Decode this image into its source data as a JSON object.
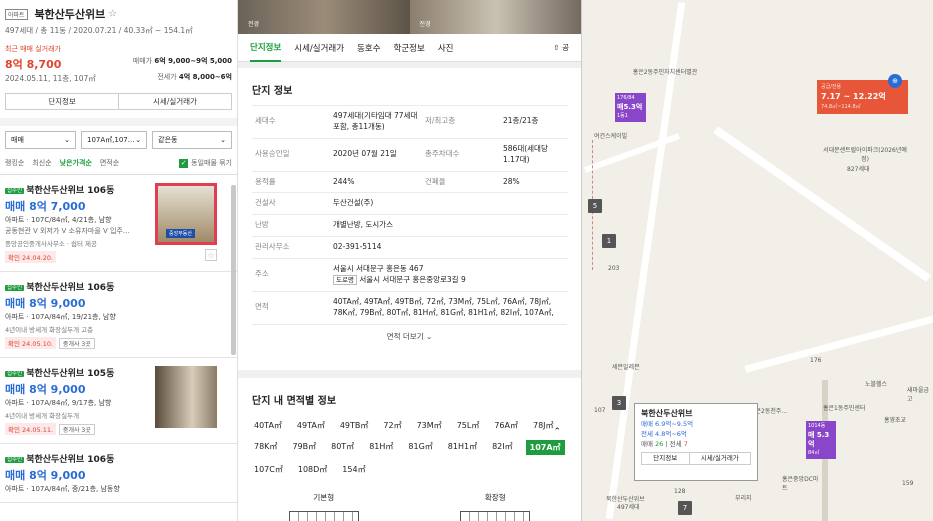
{
  "left": {
    "badge": "아파트",
    "title": "북한산두산위브",
    "star": "☆",
    "summary": "497세대 / 총 11동 / 2020.07.21 / 40.33㎡ ~ 154.1㎡",
    "recent_label": "최근 매매 실거래가",
    "recent_price": "8억 8,700",
    "recent_date": "2024.05.11, 11층, 107㎡",
    "sale_label": "매매가",
    "sale_range": "6억 9,000~9억 5,000",
    "jeonse_label": "전세가",
    "jeonse_range": "4억 8,000~6억",
    "btn_info": "단지정보",
    "btn_price": "시세/실거래가",
    "filters": [
      "매매",
      "107A㎡,107...",
      "같은동"
    ],
    "sorts": [
      "랭킹순",
      "최신순",
      "낮은가격순",
      "면적순"
    ],
    "group_toggle": "동일매물 묶기",
    "listings": [
      {
        "tag": "집주인",
        "name": "북한산두산위브 106동",
        "price": "매매 8억 7,000",
        "info": "아파트 · 107C/84㎡, 4/21층, 남향",
        "desc": "공동현관 V 외저가 V 소유자마을 V 입주...",
        "agent": "중앙공인중개사사무소 · 쉽터 제공",
        "date": "확인 24.04.20.",
        "thumb_caption": "중앙부동산"
      },
      {
        "tag": "집주인",
        "name": "북한산두산위브 106동",
        "price": "매매 8억 9,000",
        "info": "아파트 · 107A/84㎡, 19/21층, 남향",
        "desc": "4년이내  방세개  화장실두개  고층",
        "date": "확인 24.05.10.",
        "pill": "중개사 3곳"
      },
      {
        "tag": "집주인",
        "name": "북한산두산위브 105동",
        "price": "매매 8억 9,000",
        "info": "아파트 · 107A/84㎡, 9/17층, 남향",
        "desc": "4년이내  방세개  화장실두개",
        "date": "확인 24.05.11.",
        "pill": "중개사 3곳"
      },
      {
        "tag": "집주인",
        "name": "북한산두산위브 106동",
        "price": "매매 8억 9,000",
        "info": "아파트 · 107A/84㎡, 중/21층, 남동향"
      }
    ]
  },
  "mid": {
    "tabs": [
      "단지정보",
      "시세/실거래가",
      "동호수",
      "학군정보",
      "사진"
    ],
    "share": "⇧ 공",
    "info_title": "단지 정보",
    "rows": [
      {
        "k": "세대수",
        "v": "497세대(기타임대 77세대 포함, 총11개동)",
        "k2": "저/최고층",
        "v2": "21층/21층"
      },
      {
        "k": "사용승인일",
        "v": "2020년 07월 21일",
        "k2": "총주차대수",
        "v2": "586대(세대당 1.17대)"
      },
      {
        "k": "용적률",
        "v": "244%",
        "k2": "건폐율",
        "v2": "28%"
      },
      {
        "k": "건설사",
        "v": "두산건설(주)"
      },
      {
        "k": "난방",
        "v": "개별난방, 도시가스"
      },
      {
        "k": "관리사무소",
        "v": "02-391-5114"
      },
      {
        "k": "주소",
        "v": "서울시 서대문구 홍은동 467",
        "v3_tag": "도로명",
        "v3": "서울시 서대문구 홍은중앙로3길 9"
      },
      {
        "k": "면적",
        "v": "40TA㎡, 49TA㎡, 49TB㎡, 72㎡, 73M㎡, 75L㎡, 76A㎡, 78J㎡, 78K㎡, 79B㎡, 80T㎡, 81H㎡, 81G㎡, 81H1㎡, 82I㎡, 107A㎡,"
      }
    ],
    "more": "면적 더보기",
    "area_title": "단지 내 면적별 정보",
    "areas": [
      "40TA㎡",
      "49TA㎡",
      "49TB㎡",
      "72㎡",
      "73M㎡",
      "75L㎡",
      "76A㎡",
      "78J㎡",
      "78K㎡",
      "79B㎡",
      "80T㎡",
      "81H㎡",
      "81G㎡",
      "81H1㎡",
      "82I㎡",
      "107A㎡",
      "107C㎡",
      "108D㎡",
      "154㎡"
    ],
    "plan_labels": [
      "기본형",
      "확장형"
    ],
    "photo_labels": [
      "전경",
      "전경"
    ]
  },
  "map": {
    "labels": [
      "홍은2동주민자치센터별관",
      "여건스케이빌",
      "서대문센트럴아이파크(2026년예정)",
      "827세대",
      "홍은2동천주...",
      "노블헬스",
      "새마을금고",
      "홍은1동주민센터",
      "홍영초교",
      "세븐일레븐",
      "북한산두산위브",
      "497세대",
      "홍은중앙DC마트",
      "부리지"
    ],
    "m1": "매5.3억",
    "m1_top": "176/84",
    "m1_sub": "1동1",
    "m3": "매 5.3억",
    "m3_top": "1014동",
    "m3_sub": "84㎡",
    "red_top": "공급/전용",
    "red_price": "7.17 ~ 12.22억",
    "red_sub": "74.8㎡~114.8㎡",
    "nums": [
      "5",
      "1",
      "3",
      "7"
    ],
    "popup": {
      "title": "북한산두산위브",
      "sale": "매매 6.9억~9.5억",
      "jeonse": "전세 4.8억~6억",
      "counts_prefix": "매매",
      "sale_cnt": "26",
      "counts_sep": "| 전세",
      "jeonse_cnt": "7",
      "btn1": "단지정보",
      "btn2": "시세/실거래가"
    },
    "small_num": "203",
    "small_num2": "107",
    "small_num3": "176",
    "small_num4": "128",
    "small_num5": "159"
  },
  "colors": {
    "green": "#1e9c3f",
    "blue": "#2a6cd6",
    "red": "#e0452c",
    "purple": "#8a46c8"
  }
}
